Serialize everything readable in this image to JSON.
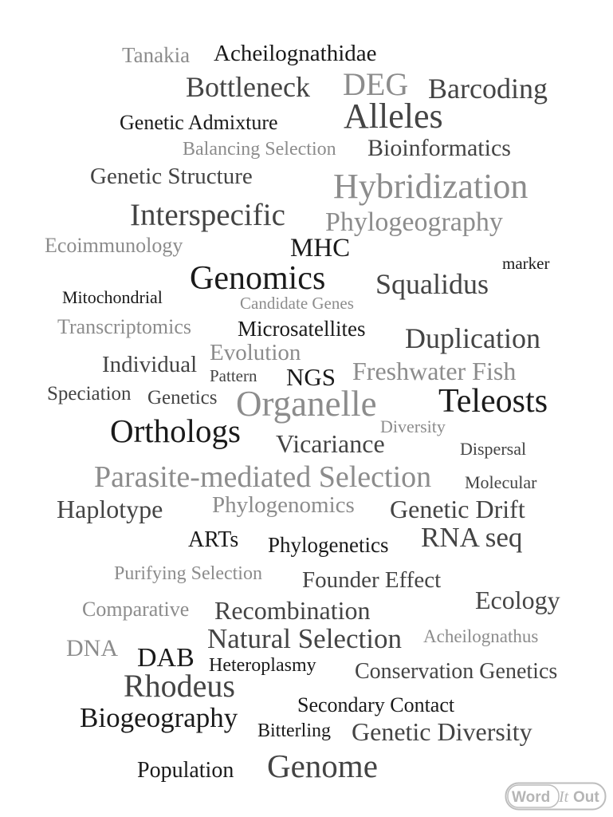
{
  "colors": {
    "dark": "#1a1a1a",
    "mid": "#444444",
    "light": "#8c8c8c",
    "background": "#ffffff"
  },
  "words": [
    {
      "text": "Tanakia",
      "tone": "light"
    },
    {
      "text": "Acheilognathidae",
      "tone": "dark"
    },
    {
      "text": "Bottleneck",
      "tone": "mid"
    },
    {
      "text": "DEG",
      "tone": "light"
    },
    {
      "text": "Barcoding",
      "tone": "mid"
    },
    {
      "text": "Genetic Admixture",
      "tone": "dark"
    },
    {
      "text": "Alleles",
      "tone": "mid"
    },
    {
      "text": "Balancing Selection",
      "tone": "light"
    },
    {
      "text": "Bioinformatics",
      "tone": "mid"
    },
    {
      "text": "Genetic Structure",
      "tone": "mid"
    },
    {
      "text": "Hybridization",
      "tone": "light"
    },
    {
      "text": "Interspecific",
      "tone": "mid"
    },
    {
      "text": "Phylogeography",
      "tone": "light"
    },
    {
      "text": "Ecoimmunology",
      "tone": "light"
    },
    {
      "text": "MHC",
      "tone": "dark"
    },
    {
      "text": "marker",
      "tone": "dark"
    },
    {
      "text": "Genomics",
      "tone": "dark"
    },
    {
      "text": "Squalidus",
      "tone": "mid"
    },
    {
      "text": "Mitochondrial",
      "tone": "dark"
    },
    {
      "text": "Candidate Genes",
      "tone": "light"
    },
    {
      "text": "Transcriptomics",
      "tone": "light"
    },
    {
      "text": "Microsatellites",
      "tone": "dark"
    },
    {
      "text": "Duplication",
      "tone": "mid"
    },
    {
      "text": "Evolution",
      "tone": "light"
    },
    {
      "text": "Individual",
      "tone": "mid"
    },
    {
      "text": "Pattern",
      "tone": "mid"
    },
    {
      "text": "NGS",
      "tone": "dark"
    },
    {
      "text": "Freshwater Fish",
      "tone": "light"
    },
    {
      "text": "Speciation",
      "tone": "mid"
    },
    {
      "text": "Genetics",
      "tone": "mid"
    },
    {
      "text": "Organelle",
      "tone": "light"
    },
    {
      "text": "Teleosts",
      "tone": "dark"
    },
    {
      "text": "Diversity",
      "tone": "light"
    },
    {
      "text": "Orthologs",
      "tone": "dark"
    },
    {
      "text": "Vicariance",
      "tone": "mid"
    },
    {
      "text": "Dispersal",
      "tone": "mid"
    },
    {
      "text": "Parasite-mediated Selection",
      "tone": "light"
    },
    {
      "text": "Molecular",
      "tone": "mid"
    },
    {
      "text": "Haplotype",
      "tone": "mid"
    },
    {
      "text": "Phylogenomics",
      "tone": "light"
    },
    {
      "text": "Genetic Drift",
      "tone": "mid"
    },
    {
      "text": "ARTs",
      "tone": "dark"
    },
    {
      "text": "Phylogenetics",
      "tone": "dark"
    },
    {
      "text": "RNA seq",
      "tone": "mid"
    },
    {
      "text": "Purifying Selection",
      "tone": "light"
    },
    {
      "text": "Founder Effect",
      "tone": "mid"
    },
    {
      "text": "Ecology",
      "tone": "mid"
    },
    {
      "text": "Comparative",
      "tone": "light"
    },
    {
      "text": "Recombination",
      "tone": "mid"
    },
    {
      "text": "DNA",
      "tone": "light"
    },
    {
      "text": "Natural Selection",
      "tone": "mid"
    },
    {
      "text": "Acheilognathus",
      "tone": "light"
    },
    {
      "text": "DAB",
      "tone": "dark"
    },
    {
      "text": "Heteroplasmy",
      "tone": "dark"
    },
    {
      "text": "Rhodeus",
      "tone": "mid"
    },
    {
      "text": "Conservation Genetics",
      "tone": "mid"
    },
    {
      "text": "Secondary Contact",
      "tone": "dark"
    },
    {
      "text": "Biogeography",
      "tone": "dark"
    },
    {
      "text": "Bitterling",
      "tone": "dark"
    },
    {
      "text": "Genetic Diversity",
      "tone": "mid"
    },
    {
      "text": "Population",
      "tone": "dark"
    },
    {
      "text": "Genome",
      "tone": "mid"
    }
  ],
  "logo": {
    "word": "Word",
    "it": "It",
    "out": "Out"
  }
}
